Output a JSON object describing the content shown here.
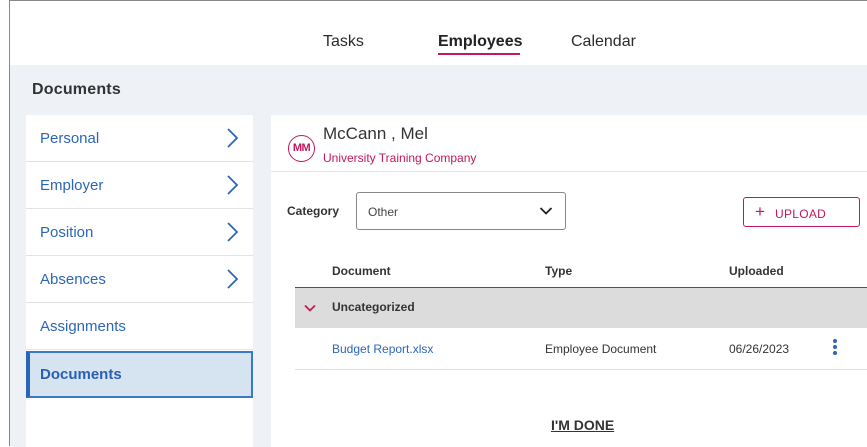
{
  "nav": {
    "tabs": [
      {
        "label": "Tasks",
        "active": false
      },
      {
        "label": "Employees",
        "active": true
      },
      {
        "label": "Calendar",
        "active": false
      }
    ]
  },
  "section_title": "Documents",
  "sidebar": {
    "items": [
      {
        "label": "Personal",
        "has_chevron": true,
        "active": false
      },
      {
        "label": "Employer",
        "has_chevron": true,
        "active": false
      },
      {
        "label": "Position",
        "has_chevron": true,
        "active": false
      },
      {
        "label": "Absences",
        "has_chevron": true,
        "active": false
      },
      {
        "label": "Assignments",
        "has_chevron": false,
        "active": false
      },
      {
        "label": "Documents",
        "has_chevron": false,
        "active": true
      }
    ]
  },
  "employee": {
    "initials": "MM",
    "name": "McCann , Mel",
    "company": "University Training Company"
  },
  "filter": {
    "category_label": "Category",
    "category_value": "Other"
  },
  "upload": {
    "plus": "+",
    "label": "UPLOAD"
  },
  "table": {
    "headers": {
      "document": "Document",
      "type": "Type",
      "uploaded": "Uploaded"
    },
    "group": {
      "label": "Uncategorized"
    },
    "rows": [
      {
        "document": "Budget Report.xlsx",
        "type": "Employee Document",
        "uploaded": "06/26/2023"
      }
    ]
  },
  "done_label": "I'M DONE",
  "colors": {
    "accent": "#c2185b",
    "link": "#2c66b8",
    "active_bg": "#d6e4f1",
    "page_bg": "#eef1f6",
    "group_bg": "#dcdcdc"
  },
  "icons": {
    "sidebar_chevron": "chevron-right-icon",
    "select_chevron": "chevron-down-icon",
    "group_chevron": "chevron-down-icon",
    "row_menu": "more-vertical-icon"
  }
}
